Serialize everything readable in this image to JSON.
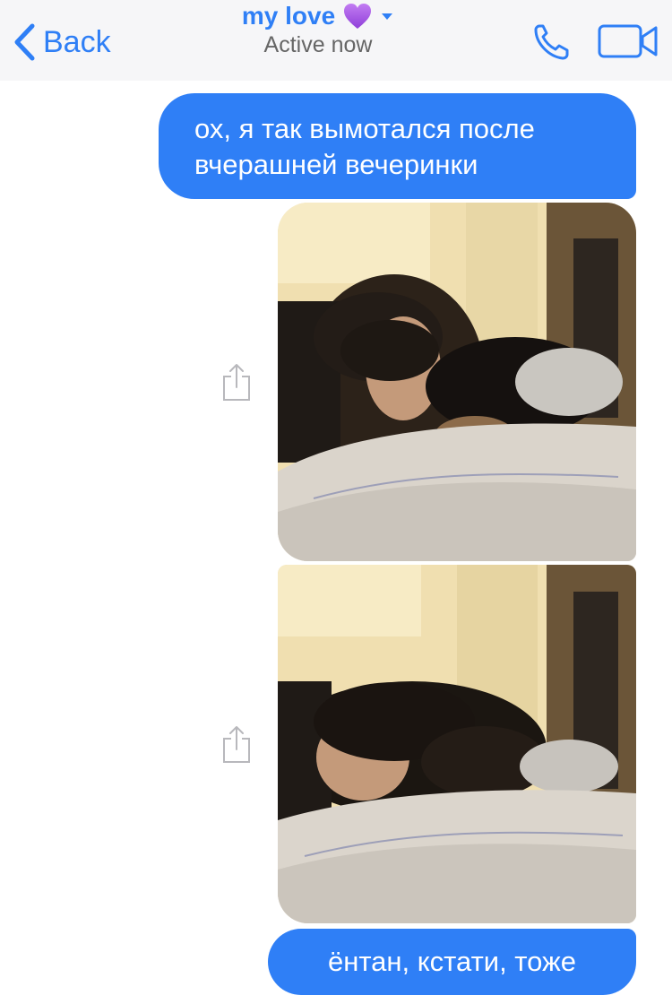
{
  "header": {
    "back_label": "Back",
    "title": "my love",
    "title_emoji": "💜",
    "status": "Active now",
    "accent_color": "#2f7ff6",
    "icons": [
      "chevron-left-icon",
      "purple-heart-icon",
      "dropdown-arrow-icon",
      "phone-icon",
      "video-camera-icon"
    ]
  },
  "messages": [
    {
      "type": "text",
      "direction": "outgoing",
      "text": "ох, я так вымотался после вчерашней вечеринки"
    },
    {
      "type": "photo",
      "direction": "outgoing",
      "icon": "share-icon"
    },
    {
      "type": "photo",
      "direction": "outgoing",
      "icon": "share-icon"
    },
    {
      "type": "text",
      "direction": "outgoing",
      "text": "ёнтан, кстати, тоже"
    }
  ],
  "colors": {
    "bubble": "#2f7ff6",
    "header_bg": "#f6f6f8",
    "status_text": "#666666"
  }
}
